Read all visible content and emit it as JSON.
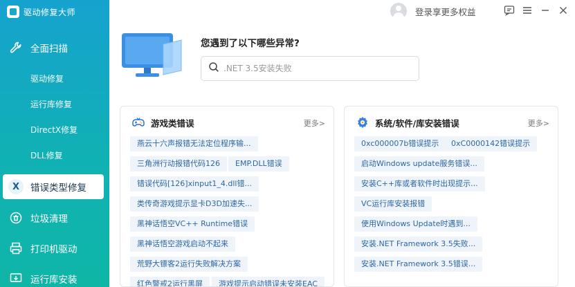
{
  "app": {
    "title": "驱动修复大师"
  },
  "sidebar": {
    "scan_label": "全面扫描",
    "sub_items": [
      "驱动修复",
      "运行库修复",
      "DirectX修复",
      "DLL修复"
    ],
    "active_label": "错误类型修复",
    "active_icon_letter": "X",
    "items": [
      "垃圾清理",
      "打印机驱动",
      "运行库安装"
    ]
  },
  "topbar": {
    "login_text": "登录享更多权益"
  },
  "hero": {
    "question": "您遇到了以下哪些异常?",
    "search_placeholder": ".NET 3.5安装失败"
  },
  "panels": {
    "games": {
      "title": "游戏类错误",
      "more": "更多>",
      "tags": [
        "燕云十六声报错无法定位程序输...",
        "三角洲行动报错代码126",
        "EMP.DLL错误",
        "错误代码[126]xinput1_4.dll错...",
        "类传奇游戏提示显卡D3D加速失...",
        "黑神话悟空VC++ Runtime错误",
        "黑神话悟空游戏启动不起来",
        "荒野大镖客2运行失败解决方案",
        "红色警戒2运行黑屏",
        "游戏提示启动错误未安装EAC"
      ]
    },
    "system": {
      "title": "系统/软件/库安装错误",
      "more": "更多>",
      "tags": [
        "0xc000007b错误提示",
        "0xC0000142错误提示",
        "启动Windows update服务错误...",
        "安装C++库或者软件时出现提示...",
        "VC运行库安装报错",
        "使用Windows Update时遇到...",
        "安装.NET Framework 3.5失败...",
        "安装.NET Framework 3.5错误..."
      ]
    }
  },
  "colors": {
    "accent": "#16a2cf",
    "sidebar_end": "#0fb6a6",
    "tag_bg": "#eef4fa",
    "tag_text": "#2e67a3"
  }
}
